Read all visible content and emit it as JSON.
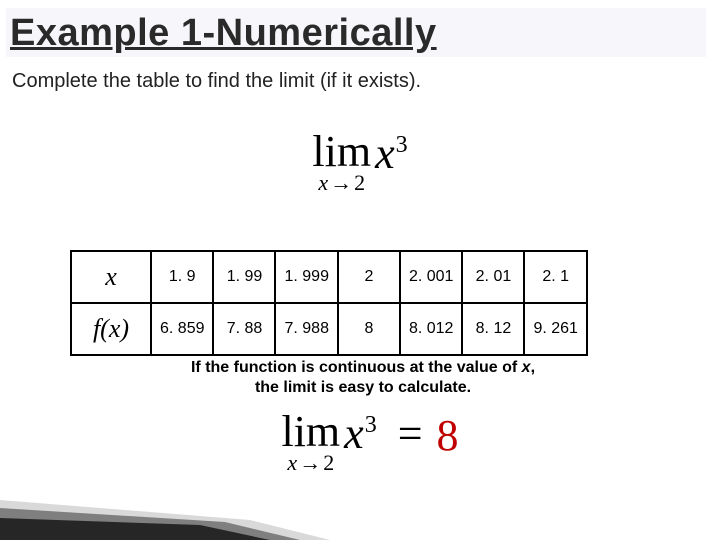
{
  "title": "Example 1-Numerically",
  "subtitle": "Complete the table to find the limit (if it exists).",
  "limit1": {
    "lim": "lim",
    "sub_lhs": "x",
    "arrow": "→",
    "sub_rhs": "2",
    "var": "x",
    "exp": "3"
  },
  "table": {
    "headers": {
      "x": "x",
      "fx": "f(x)"
    },
    "x": [
      "1. 9",
      "1. 99",
      "1. 999",
      "2",
      "2. 001",
      "2. 01",
      "2. 1"
    ],
    "fx": [
      "6. 859",
      "7. 88",
      "7. 988",
      "8",
      "8. 012",
      "8. 12",
      "9. 261"
    ]
  },
  "note": {
    "line1_a": "If the function is continuous at the value of ",
    "line1_x": "x",
    "line1_b": ",",
    "line2": "the limit is easy to calculate."
  },
  "limit2": {
    "lim": "lim",
    "sub_lhs": "x",
    "arrow": "→",
    "sub_rhs": "2",
    "var": "x",
    "exp": "3",
    "eq": "=",
    "ans": "8"
  },
  "chart_data": {
    "type": "table",
    "columns": [
      "x",
      "f(x)"
    ],
    "rows": [
      [
        1.9,
        6.859
      ],
      [
        1.99,
        7.88
      ],
      [
        1.999,
        7.988
      ],
      [
        2,
        8
      ],
      [
        2.001,
        8.012
      ],
      [
        2.01,
        8.12
      ],
      [
        2.1,
        9.261
      ]
    ],
    "title": "lim_{x→2} x^3",
    "answer": 8
  }
}
